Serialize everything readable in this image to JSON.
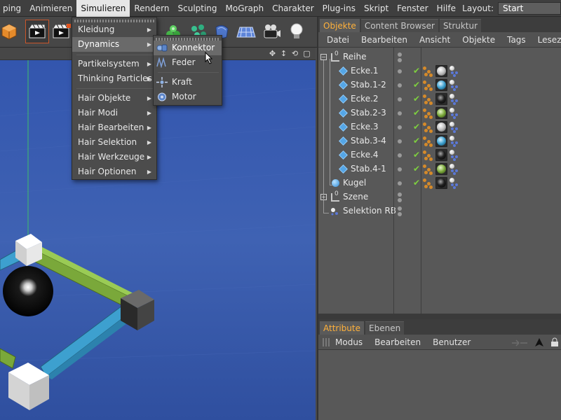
{
  "menubar": {
    "items": [
      "ping",
      "Animieren",
      "Simulieren",
      "Rendern",
      "Sculpting",
      "MoGraph",
      "Charakter",
      "Plug-ins",
      "Skript",
      "Fenster",
      "Hilfe"
    ],
    "active": "Simulieren",
    "layout_label": "Layout:",
    "layout_value": "Start"
  },
  "simulieren_menu": {
    "items": [
      "Kleidung",
      "Dynamics",
      "Partikelsystem",
      "Thinking Particles",
      "Hair Objekte",
      "Hair Modi",
      "Hair Bearbeiten",
      "Hair Selektion",
      "Hair Werkzeuge",
      "Hair Optionen"
    ],
    "highlighted": "Dynamics"
  },
  "dynamics_submenu": {
    "items": [
      "Konnektor",
      "Feder",
      "Kraft",
      "Motor"
    ],
    "highlighted": "Konnektor"
  },
  "objects_panel": {
    "tabs": [
      "Objekte",
      "Content Browser",
      "Struktur"
    ],
    "active_tab": "Objekte",
    "menu": [
      "Datei",
      "Bearbeiten",
      "Ansicht",
      "Objekte",
      "Tags",
      "Lesezeichen"
    ],
    "objects": [
      {
        "name": "Reihe",
        "type": "null",
        "indent": 0
      },
      {
        "name": "Ecke.1",
        "type": "cube",
        "indent": 1,
        "material": "white"
      },
      {
        "name": "Stab.1-2",
        "type": "cube",
        "indent": 1,
        "material": "blue"
      },
      {
        "name": "Ecke.2",
        "type": "cube",
        "indent": 1,
        "material": "black"
      },
      {
        "name": "Stab.2-3",
        "type": "cube",
        "indent": 1,
        "material": "green"
      },
      {
        "name": "Ecke.3",
        "type": "cube",
        "indent": 1,
        "material": "white"
      },
      {
        "name": "Stab.3-4",
        "type": "cube",
        "indent": 1,
        "material": "blue"
      },
      {
        "name": "Ecke.4",
        "type": "cube",
        "indent": 1,
        "material": "black"
      },
      {
        "name": "Stab.4-1",
        "type": "cube",
        "indent": 1,
        "material": "green"
      },
      {
        "name": "Kugel",
        "type": "sphere",
        "indent": 0,
        "material": "black"
      },
      {
        "name": "Szene",
        "type": "null",
        "indent": 0
      },
      {
        "name": "Selektion RB",
        "type": "selection",
        "indent": 0
      }
    ]
  },
  "attribute_panel": {
    "tabs": [
      "Attribute",
      "Ebenen"
    ],
    "active_tab": "Attribute",
    "menu": [
      "Modus",
      "Bearbeiten",
      "Benutzer"
    ]
  },
  "colors": {
    "accent": "#ffb13b",
    "viewport_sky": "#3b5aa8",
    "rod_blue": "#3da0cf",
    "rod_green": "#7aa83a",
    "check_green": "#7ecf3f"
  }
}
